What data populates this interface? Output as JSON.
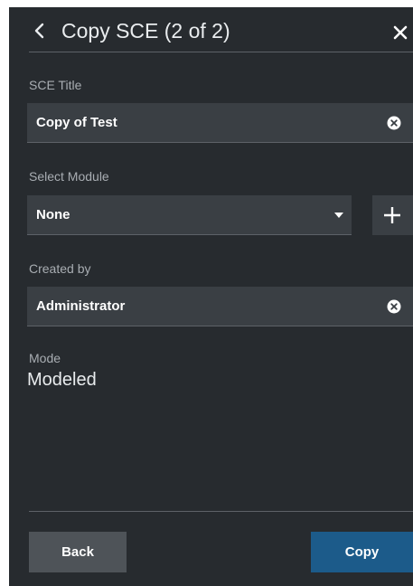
{
  "header": {
    "title": "Copy SCE (2 of 2)",
    "back_icon": "chevron-left-icon",
    "close_icon": "close-icon"
  },
  "form": {
    "sce_title": {
      "label": "SCE Title",
      "value": "Copy of Test"
    },
    "module": {
      "label": "Select Module",
      "value": "None",
      "add_icon": "plus-icon"
    },
    "created_by": {
      "label": "Created by",
      "value": "Administrator"
    },
    "mode": {
      "label": "Mode",
      "value": "Modeled"
    }
  },
  "footer": {
    "back_label": "Back",
    "copy_label": "Copy"
  },
  "colors": {
    "panel_bg": "#272b2f",
    "field_bg": "#3a3f44",
    "primary_button": "#1c5b8a",
    "secondary_button": "#4e5358"
  }
}
